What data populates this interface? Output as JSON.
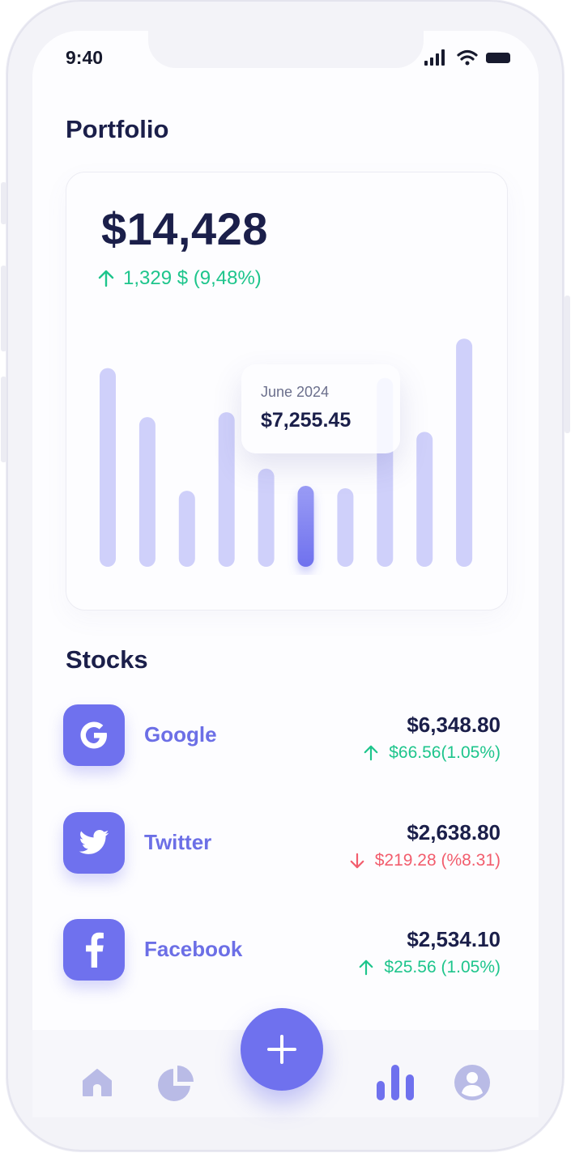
{
  "status": {
    "time": "9:40"
  },
  "page_title": "Portfolio",
  "portfolio": {
    "total": "$14,428",
    "change": "1,329 $ (9,48%)"
  },
  "tooltip": {
    "label": "June 2024",
    "value": "$7,255.45"
  },
  "chart_data": {
    "type": "bar",
    "values": [
      8.1,
      6.1,
      3.1,
      6.3,
      4.0,
      3.3,
      3.2,
      7.7,
      5.5,
      9.3
    ],
    "highlighted_index": 5,
    "ylim": [
      0,
      10
    ],
    "bar_color": "#cfd0fa",
    "highlight_color": "#6f71ee",
    "grid": false
  },
  "stocks_title": "Stocks",
  "stocks": [
    {
      "name": "Google",
      "icon": "google-logo-icon",
      "price": "$6,348.80",
      "change": "$66.56(1.05%)",
      "direction": "up"
    },
    {
      "name": "Twitter",
      "icon": "twitter-bird-icon",
      "price": "$2,638.80",
      "change": "$219.28 (%8.31)",
      "direction": "down"
    },
    {
      "name": "Facebook",
      "icon": "facebook-f-icon",
      "price": "$2,534.10",
      "change": "$25.56 (1.05%)",
      "direction": "up"
    }
  ],
  "colors": {
    "accent": "#6f71ee",
    "positive": "#1ec58c",
    "negative": "#f25d6d",
    "text_dark": "#1b1f4a"
  },
  "nav": {
    "items": [
      "home-icon",
      "pie-chart-icon",
      "add-icon",
      "bar-chart-icon",
      "profile-icon"
    ],
    "active": "bar-chart-icon"
  }
}
